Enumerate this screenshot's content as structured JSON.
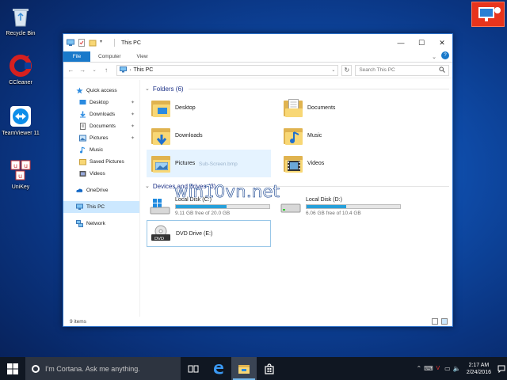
{
  "desktop": {
    "icons": [
      {
        "label": "Recycle Bin",
        "icon": "recycle-bin-icon"
      },
      {
        "label": "CCleaner",
        "icon": "ccleaner-icon"
      },
      {
        "label": "TeamViewer 11",
        "icon": "teamviewer-icon"
      },
      {
        "label": "UniKey",
        "icon": "unikey-icon"
      }
    ]
  },
  "window": {
    "title": "This PC",
    "controls": {
      "minimize": "—",
      "maximize": "☐",
      "close": "✕"
    },
    "ribbon_tabs": [
      "File",
      "Computer",
      "View"
    ],
    "help": "?",
    "address": {
      "path": "This PC",
      "search_placeholder": "Search This PC"
    },
    "nav": [
      {
        "label": "Quick access",
        "icon": "star-icon",
        "level": 0
      },
      {
        "label": "Desktop",
        "icon": "desktop-icon",
        "level": 1,
        "pinned": true
      },
      {
        "label": "Downloads",
        "icon": "downloads-icon",
        "level": 1,
        "pinned": true
      },
      {
        "label": "Documents",
        "icon": "documents-icon",
        "level": 1,
        "pinned": true
      },
      {
        "label": "Pictures",
        "icon": "pictures-icon",
        "level": 1,
        "pinned": true
      },
      {
        "label": "Music",
        "icon": "music-icon",
        "level": 1,
        "pinned": false
      },
      {
        "label": "Saved Pictures",
        "icon": "folder-icon",
        "level": 1,
        "pinned": false
      },
      {
        "label": "Videos",
        "icon": "videos-icon",
        "level": 1,
        "pinned": false
      },
      {
        "label": "OneDrive",
        "icon": "onedrive-icon",
        "level": 0
      },
      {
        "label": "This PC",
        "icon": "this-pc-icon",
        "level": 0,
        "selected": true
      },
      {
        "label": "Network",
        "icon": "network-icon",
        "level": 0
      }
    ],
    "folders_header": "Folders (6)",
    "folders": [
      {
        "label": "Desktop",
        "icon": "desktop-folder-icon"
      },
      {
        "label": "Documents",
        "icon": "documents-folder-icon"
      },
      {
        "label": "Downloads",
        "icon": "downloads-folder-icon"
      },
      {
        "label": "Music",
        "icon": "music-folder-icon"
      },
      {
        "label": "Pictures",
        "icon": "pictures-folder-icon",
        "ghost": "Sub-Screen.bmp"
      },
      {
        "label": "Videos",
        "icon": "videos-folder-icon"
      }
    ],
    "devices_header": "Devices and drives (3)",
    "drives": [
      {
        "label": "Local Disk (C:)",
        "icon": "windows-drive-icon",
        "free": "9.11 GB free of 20.0 GB",
        "used_fraction": 0.54,
        "bar": true
      },
      {
        "label": "Local Disk (D:)",
        "icon": "hard-drive-icon",
        "free": "6.06 GB free of 10.4 GB",
        "used_fraction": 0.42,
        "bar": true
      },
      {
        "label": "DVD Drive (E:)",
        "icon": "dvd-drive-icon",
        "free": "",
        "bar": false
      }
    ],
    "status": "9 items"
  },
  "watermark": "win10vn.net",
  "taskbar": {
    "cortana_placeholder": "I'm Cortana. Ask me anything.",
    "time": "2:17 AM",
    "date": "2/24/2016",
    "accent": "#76b9ed"
  },
  "colors": {
    "file_tab": "#1979ca",
    "selection": "#cce8ff",
    "drive_bar": "#26a0da",
    "section_header": "#1e3287"
  }
}
